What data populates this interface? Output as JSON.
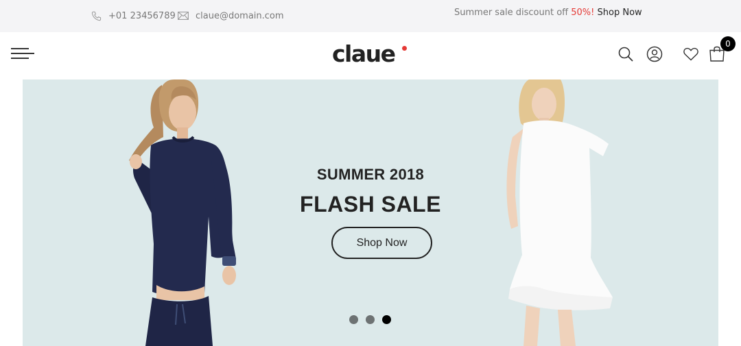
{
  "topbar": {
    "phone": "+01 23456789",
    "email": "claue@domain.com",
    "promo_text": "Summer sale discount off ",
    "promo_highlight": "50%!",
    "promo_link": "Shop Now",
    "highlight_color": "#e53935"
  },
  "header": {
    "logo": "claue",
    "icons": [
      "menu-icon",
      "search-icon",
      "user-icon",
      "heart-icon",
      "cart-icon"
    ],
    "cart_count": "0"
  },
  "hero": {
    "subtitle": "SUMMER 2018",
    "title": "FLASH SALE",
    "button": "Shop Now",
    "background": "#dce9ea",
    "slides": 3,
    "active_slide": 3
  }
}
